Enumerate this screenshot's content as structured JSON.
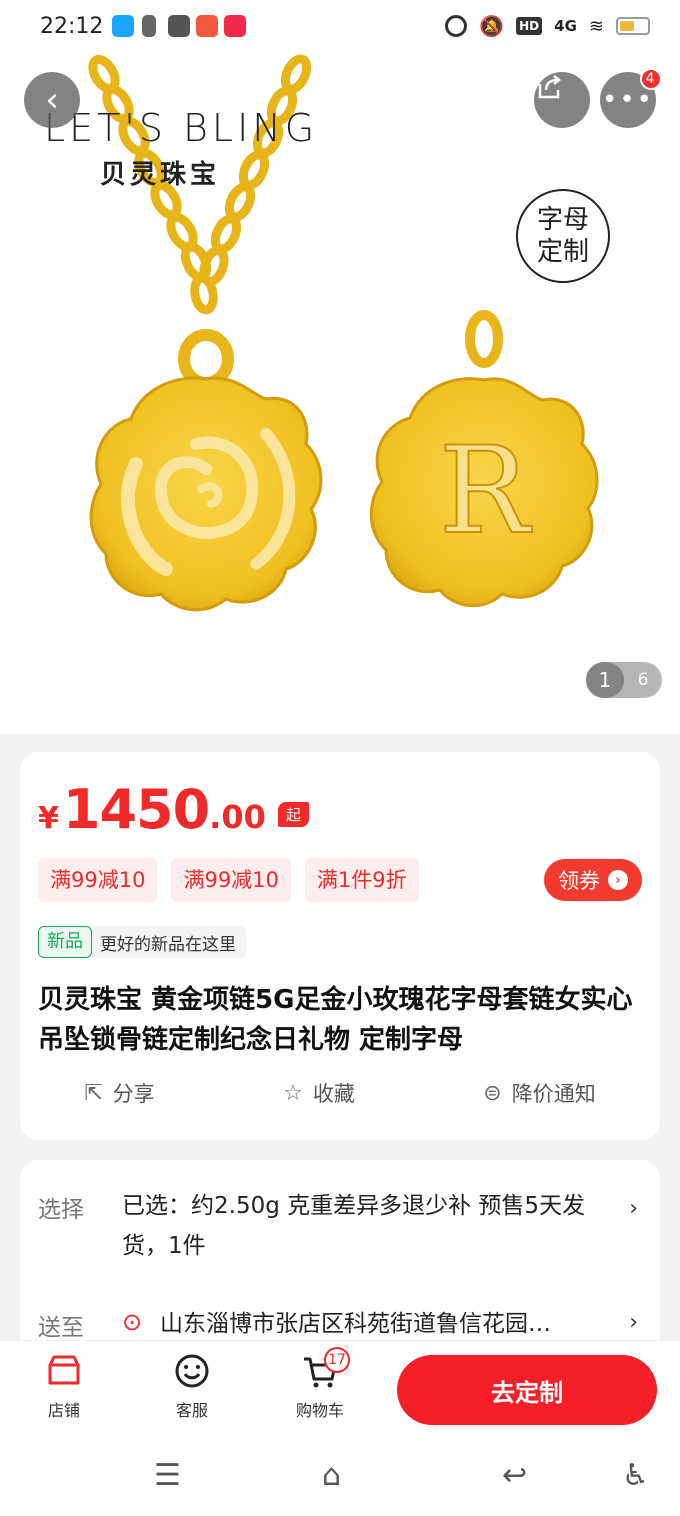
{
  "status_bar": {
    "time": "22:12",
    "network": "4G",
    "hd": "HD",
    "app_colors": [
      "#1aa3ff",
      "#555555",
      "#666666",
      "#f05a3a",
      "#f02a4a"
    ]
  },
  "hero": {
    "brand_en": "LET'S BLING",
    "brand_cn": "贝灵珠宝",
    "custom_badge": "字母定制",
    "page_current": "1",
    "page_total": "6",
    "more_count": "4"
  },
  "price": {
    "currency": "¥",
    "integer": "1450",
    "decimal": ".00",
    "from_tag": "起"
  },
  "coupons": [
    "满99减10",
    "满99减10",
    "满1件9折"
  ],
  "get_coupon": "领券",
  "new_tag": {
    "label": "新品",
    "text": "更好的新品在这里"
  },
  "title": "贝灵珠宝  黄金项链5G足金小玫瑰花字母套链女实心吊坠锁骨链定制纪念日礼物  定制字母",
  "actions": {
    "share": "分享",
    "favorite": "收藏",
    "price_alert": "降价通知"
  },
  "selection": {
    "label": "选择",
    "value": "已选：约2.50g  克重差异多退少补  预售5天发货，1件"
  },
  "delivery": {
    "label": "送至",
    "address": "山东淄博市张店区科苑街道鲁信花园…"
  },
  "bottom_bar": {
    "store": "店铺",
    "service": "客服",
    "cart": "购物车",
    "cart_count": "17",
    "cta": "去定制"
  },
  "colors": {
    "accent_red": "#f02a2a",
    "gold": "#f3c62a",
    "green_tag": "#1aa55a"
  }
}
